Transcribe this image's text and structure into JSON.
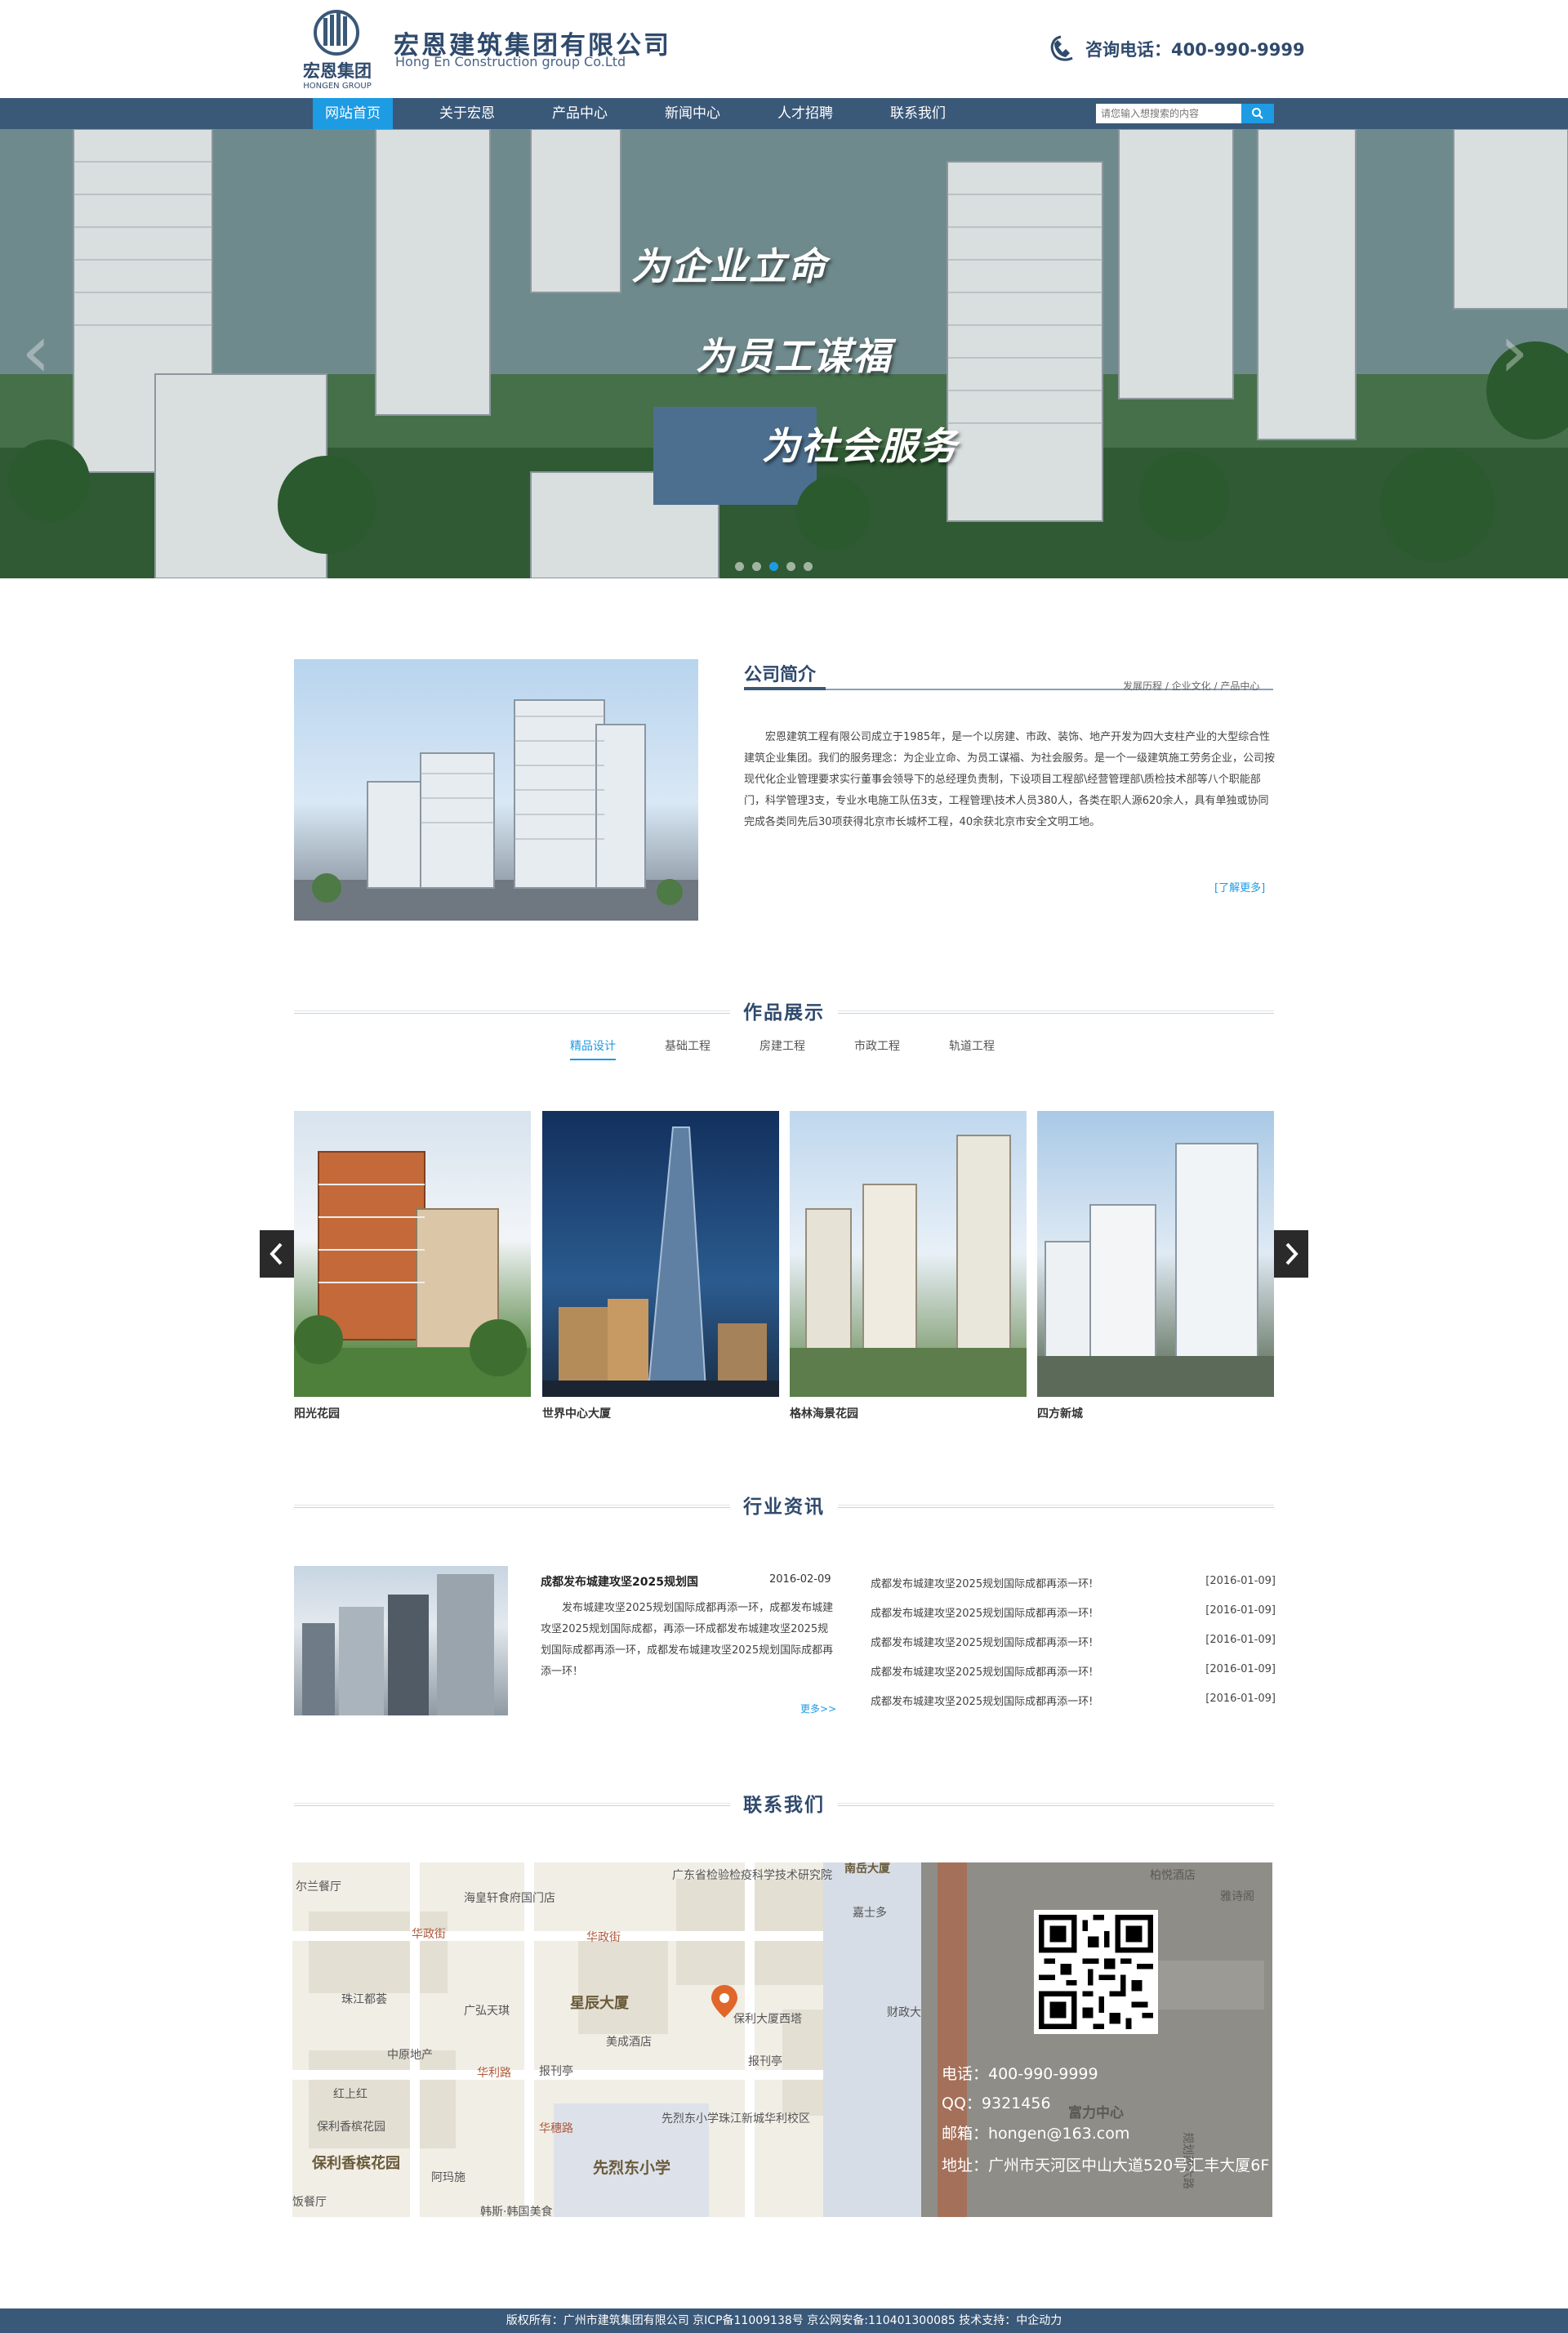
{
  "header": {
    "logo_cn": "宏恩集团",
    "logo_en": "HONGEN GROUP",
    "company_cn": "宏恩建筑集团有限公司",
    "company_en": "Hong En Construction group Co.Ltd",
    "hotline": "咨询电话：400-990-9999"
  },
  "nav": {
    "items": [
      {
        "label": "网站首页",
        "active": true
      },
      {
        "label": "关于宏恩",
        "active": false
      },
      {
        "label": "产品中心",
        "active": false
      },
      {
        "label": "新闻中心",
        "active": false
      },
      {
        "label": "人才招聘",
        "active": false
      },
      {
        "label": "联系我们",
        "active": false
      }
    ],
    "search_placeholder": "请您输入想搜索的内容"
  },
  "banner": {
    "slogans": [
      "为企业立命",
      "为员工谋福",
      "为社会服务"
    ],
    "slides": 5,
    "active_slide": 3
  },
  "about": {
    "title": "公司简介",
    "links": "发展历程  /  企业文化  /  产品中心",
    "text": "宏恩建筑工程有限公司成立于1985年，是一个以房建、市政、装饰、地产开发为四大支柱产业的大型综合性建筑企业集团。我们的服务理念：为企业立命、为员工谋福、为社会服务。是一个一级建筑施工劳务企业，公司按现代化企业管理要求实行董事会领导下的总经理负责制，下设项目工程部\\经营管理部\\质检技术部等八个职能部门，科学管理3支，专业水电施工队伍3支，工程管理\\技术人员380人，各类在职人源620余人，具有单独或协同完成各类同先后30项获得北京市长城杯工程，40余获北京市安全文明工地。",
    "more": "[了解更多]"
  },
  "works": {
    "title": "作品展示",
    "tabs": [
      {
        "label": "精品设计",
        "active": true
      },
      {
        "label": "基础工程",
        "active": false
      },
      {
        "label": "房建工程",
        "active": false
      },
      {
        "label": "市政工程",
        "active": false
      },
      {
        "label": "轨道工程",
        "active": false
      }
    ],
    "items": [
      {
        "caption": "阳光花园"
      },
      {
        "caption": "世界中心大厦"
      },
      {
        "caption": "格林海景花园"
      },
      {
        "caption": "四方新城"
      }
    ]
  },
  "news": {
    "title": "行业资讯",
    "featured": {
      "headline": "成都发布城建攻坚2025规划国",
      "date": "2016-02-09",
      "summary": "发布城建攻坚2025规划国际成都再添一环，成都发布城建攻坚2025规划国际成都，再添一环成都发布城建攻坚2025规划国际成都再添一环，成都发布城建攻坚2025规划国际成都再添一环！",
      "more": "更多>>"
    },
    "list": [
      {
        "title": "成都发布城建攻坚2025规划国际成都再添一环!",
        "date": "[2016-01-09]"
      },
      {
        "title": "成都发布城建攻坚2025规划国际成都再添一环!",
        "date": "[2016-01-09]"
      },
      {
        "title": "成都发布城建攻坚2025规划国际成都再添一环!",
        "date": "[2016-01-09]"
      },
      {
        "title": "成都发布城建攻坚2025规划国际成都再添一环!",
        "date": "[2016-01-09]"
      },
      {
        "title": "成都发布城建攻坚2025规划国际成都再添一环!",
        "date": "[2016-01-09]"
      }
    ]
  },
  "contact": {
    "title": "联系我们",
    "phone": "电话：400-990-9999",
    "qq": "QQ：9321456",
    "email": "邮箱：hongen@163.com",
    "address": "地址：广州市天河区中山大道520号汇丰大厦6F",
    "map_labels": {
      "l1": "尔兰餐厅",
      "l2": "海皇轩食府国门店",
      "l3": "广东省检验检疫科学技术研究院",
      "l4": "南岳大厦",
      "l5": "嘉士多",
      "l6": "华政街",
      "l7": "华政街",
      "l8": "珠江都荟",
      "l9": "广弘天琪",
      "l10": "星辰大厦",
      "l11": "保利大厦西塔",
      "l12": "财政大厦",
      "l13": "美成酒店",
      "l14": "中原地产",
      "l15": "华利路",
      "l16": "报刊亭",
      "l17": "报刊亭",
      "l18": "红上红",
      "l19": "保利香槟花园",
      "l20": "保利香槟花园",
      "l21": "先烈东小学珠江新城华利校区",
      "l22": "华穗路",
      "l23": "先烈东小学",
      "l24": "阿玛施",
      "l25": "饭餐厅",
      "l26": "韩斯·韩国美食",
      "l27": "柏悦酒店",
      "l28": "雅诗阁",
      "l29": "富力中心",
      "l30": "规划西六路"
    }
  },
  "footer": {
    "text": "版权所有：广州市建筑集团有限公司  京ICP备11009138号  京公网安备:110401300085  技术支持：中企动力"
  }
}
